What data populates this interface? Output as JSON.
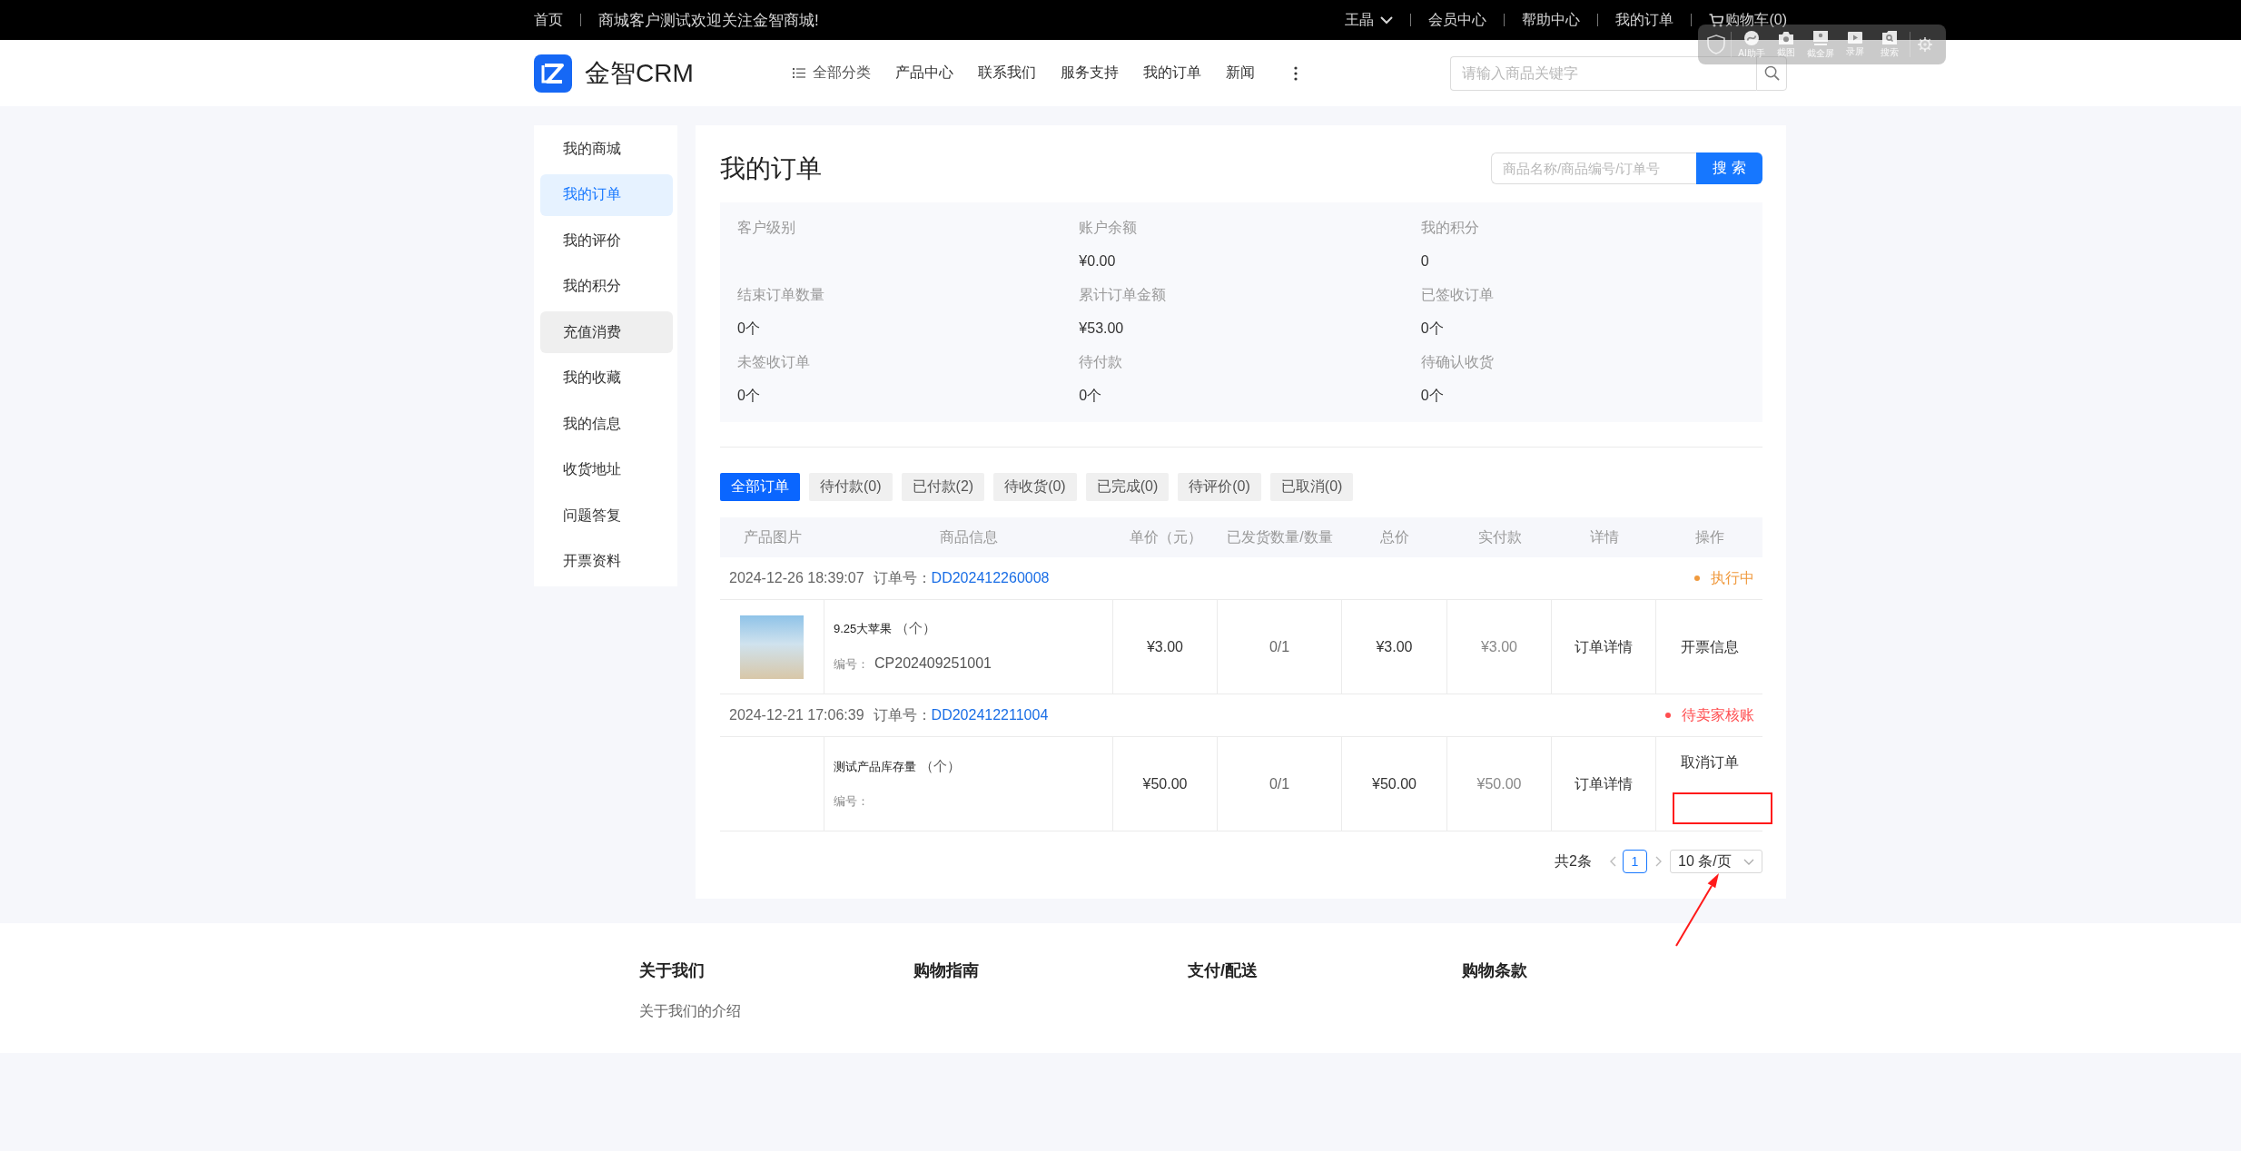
{
  "top_bar": {
    "home": "首页",
    "welcome": "商城客户测试欢迎关注金智商城!",
    "user": "王晶",
    "links": [
      "会员中心",
      "帮助中心",
      "我的订单"
    ],
    "cart": "购物车(0)"
  },
  "capture_toolbar": {
    "tools": [
      {
        "kind": "ai",
        "label": "AI助手"
      },
      {
        "kind": "capture",
        "label": "截图"
      },
      {
        "kind": "fullscreen",
        "label": "截全屏"
      },
      {
        "kind": "record",
        "label": "录屏"
      },
      {
        "kind": "search",
        "label": "搜索"
      }
    ]
  },
  "header": {
    "logo": "金智CRM",
    "nav": [
      {
        "kind": "category",
        "label": "全部分类"
      },
      {
        "kind": "link",
        "label": "产品中心"
      },
      {
        "kind": "link",
        "label": "联系我们"
      },
      {
        "kind": "link",
        "label": "服务支持"
      },
      {
        "kind": "link",
        "label": "我的订单"
      },
      {
        "kind": "link",
        "label": "新闻"
      }
    ],
    "search": {
      "placeholder": "请输入商品关键字"
    }
  },
  "sidebar": {
    "items": [
      {
        "label": "我的商城",
        "selected": false,
        "hovered": false
      },
      {
        "label": "我的订单",
        "selected": true,
        "hovered": false
      },
      {
        "label": "我的评价",
        "selected": false,
        "hovered": false
      },
      {
        "label": "我的积分",
        "selected": false,
        "hovered": false
      },
      {
        "label": "充值消费",
        "selected": false,
        "hovered": true
      },
      {
        "label": "我的收藏",
        "selected": false,
        "hovered": false
      },
      {
        "label": "我的信息",
        "selected": false,
        "hovered": false
      },
      {
        "label": "收货地址",
        "selected": false,
        "hovered": false
      },
      {
        "label": "问题答复",
        "selected": false,
        "hovered": false
      },
      {
        "label": "开票资料",
        "selected": false,
        "hovered": false
      }
    ]
  },
  "orders_panel": {
    "title": "我的订单",
    "search": {
      "placeholder": "商品名称/商品编号/订单号",
      "button": "搜 索"
    },
    "stats": [
      {
        "label": "客户级别"
      },
      {
        "label": "账户余额",
        "value": "¥0.00"
      },
      {
        "label": "我的积分",
        "value": "0"
      },
      {
        "label": "结束订单数量",
        "value": "0个"
      },
      {
        "label": "累计订单金额",
        "value": "¥53.00"
      },
      {
        "label": "已签收订单",
        "value": "0个"
      },
      {
        "label": "未签收订单",
        "value": "0个"
      },
      {
        "label": "待付款",
        "value": "0个"
      },
      {
        "label": "待确认收货",
        "value": "0个"
      }
    ],
    "tabs": [
      {
        "label": "全部订单",
        "selected": true
      },
      {
        "label": "待付款(0)",
        "selected": false
      },
      {
        "label": "已付款(2)",
        "selected": false
      },
      {
        "label": "待收货(0)",
        "selected": false
      },
      {
        "label": "已完成(0)",
        "selected": false
      },
      {
        "label": "待评价(0)",
        "selected": false
      },
      {
        "label": "已取消(0)",
        "selected": false
      }
    ],
    "table": {
      "columns": [
        "产品图片",
        "商品信息",
        "单价（元）",
        "已发货数量/数量",
        "总价",
        "实付款",
        "详情",
        "操作"
      ],
      "orders": [
        {
          "time": "2024-12-26 18:39:07",
          "order_label": "订单号：",
          "order_no": "DD202412260008",
          "status": "执行中",
          "color": "#f09a3e",
          "items": [
            {
              "photo": true,
              "name": "9.25大苹果",
              "unit": "（个）",
              "code_label": "编号：",
              "code": "CP202409251001",
              "unit_price": "¥3.00",
              "shipped": "0/1",
              "total": "¥3.00",
              "paid": "¥3.00",
              "detail": "订单详情",
              "actions": [
                "开票信息"
              ],
              "highlight_box": false
            }
          ]
        },
        {
          "time": "2024-12-21 17:06:39",
          "order_label": "订单号：",
          "order_no": "DD202412211004",
          "status": "待卖家核账",
          "color": "#ff4d4f",
          "items": [
            {
              "photo": false,
              "name": "测试产品库存量",
              "unit": "（个）",
              "code_label": "编号：",
              "unit_price": "¥50.00",
              "shipped": "0/1",
              "total": "¥50.00",
              "paid": "¥50.00",
              "detail": "订单详情",
              "actions": [
                "取消订单"
              ],
              "highlight_box": true
            }
          ]
        }
      ]
    },
    "pagination": {
      "total": "共2条",
      "pages": [
        {
          "label": "1",
          "selected": true
        }
      ],
      "page_size": "10 条/页"
    },
    "annotation_arrow": true
  },
  "footer": {
    "columns": [
      {
        "title": "关于我们",
        "links": [
          "关于我们的介绍"
        ]
      },
      {
        "title": "购物指南"
      },
      {
        "title": "支付/配送"
      },
      {
        "title": "购物条款"
      }
    ]
  }
}
